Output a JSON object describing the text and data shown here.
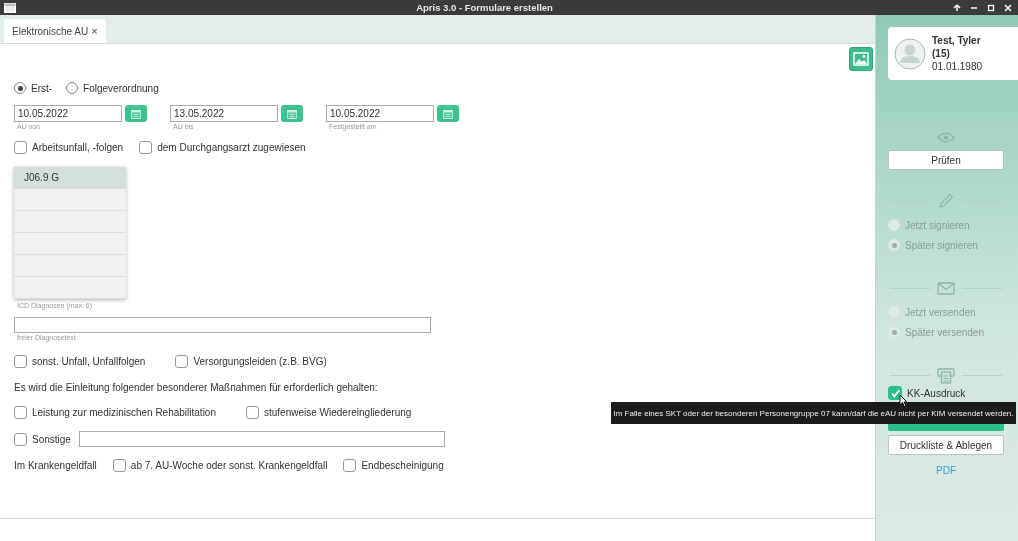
{
  "window": {
    "title": "Apris 3.0 - Formulare erstellen"
  },
  "tabs": [
    {
      "label": "Elektronische AU",
      "close": "×",
      "selected": true
    }
  ],
  "form": {
    "verordnung": [
      {
        "label": "Erst-",
        "selected": true
      },
      {
        "label": "Folgeverordnung",
        "selected": false
      }
    ],
    "dates": [
      {
        "value": "10.05.2022",
        "label": "AU von"
      },
      {
        "value": "13.05.2022",
        "label": "AU bis"
      },
      {
        "value": "10.05.2022",
        "label": "Festgestellt am"
      }
    ],
    "accident_options": [
      {
        "label": "Arbeitsunfall, -folgen",
        "checked": false
      },
      {
        "label": "dem Durchgangsarzt zugewiesen",
        "checked": false
      }
    ],
    "diagnoses": {
      "label": "ICD Diagnosen (max. 6)",
      "items": [
        {
          "code": "J06.9 G",
          "selected": true
        }
      ]
    },
    "free_text": {
      "label": "freier Diagnosetext"
    },
    "other_options": [
      {
        "label": "sonst. Unfall, Unfallfolgen",
        "checked": false
      },
      {
        "label": "Versorgungsleiden (z.B. BVG)",
        "checked": false
      }
    ],
    "measures_text": "Es wird die Einleitung folgender besonderer Maßnahmen für erforderlich gehalten:",
    "measures": [
      {
        "label": "Leistung zur medizinischen Rehabilitation",
        "checked": false
      },
      {
        "label": "stufenweise Wiedereingliederung",
        "checked": false
      }
    ],
    "sonstige": {
      "label": "Sonstige",
      "checked": false
    },
    "krankengeld": {
      "label": "Im Krankengeldfall",
      "options": [
        {
          "label": "ab 7. AU-Woche oder sonst. Krankengeldfall",
          "checked": false
        },
        {
          "label": "Endbescheinigung",
          "checked": false
        }
      ]
    }
  },
  "sidebar": {
    "patient": {
      "name": "Test, Tyler",
      "number": "(15)",
      "birthdate": "01.01.1980"
    },
    "check_button": "Prüfen",
    "sign_options": [
      {
        "label": "Jetzt signieren",
        "selected": false,
        "disabled": true
      },
      {
        "label": "Später signieren",
        "selected": true,
        "disabled": true
      }
    ],
    "send_options": [
      {
        "label": "Jetzt versenden",
        "selected": false,
        "disabled": true
      },
      {
        "label": "Später versenden",
        "selected": true,
        "disabled": true
      }
    ],
    "kk_print": {
      "label": "KK-Ausdruck",
      "checked": true
    },
    "print_list_button": "Druckliste & Ablegen",
    "pdf_link": "PDF"
  },
  "tooltip": "Im Falle eines SKT oder der besonderen Personengruppe 07 kann/darf die eAU nicht per KIM versendet werden."
}
